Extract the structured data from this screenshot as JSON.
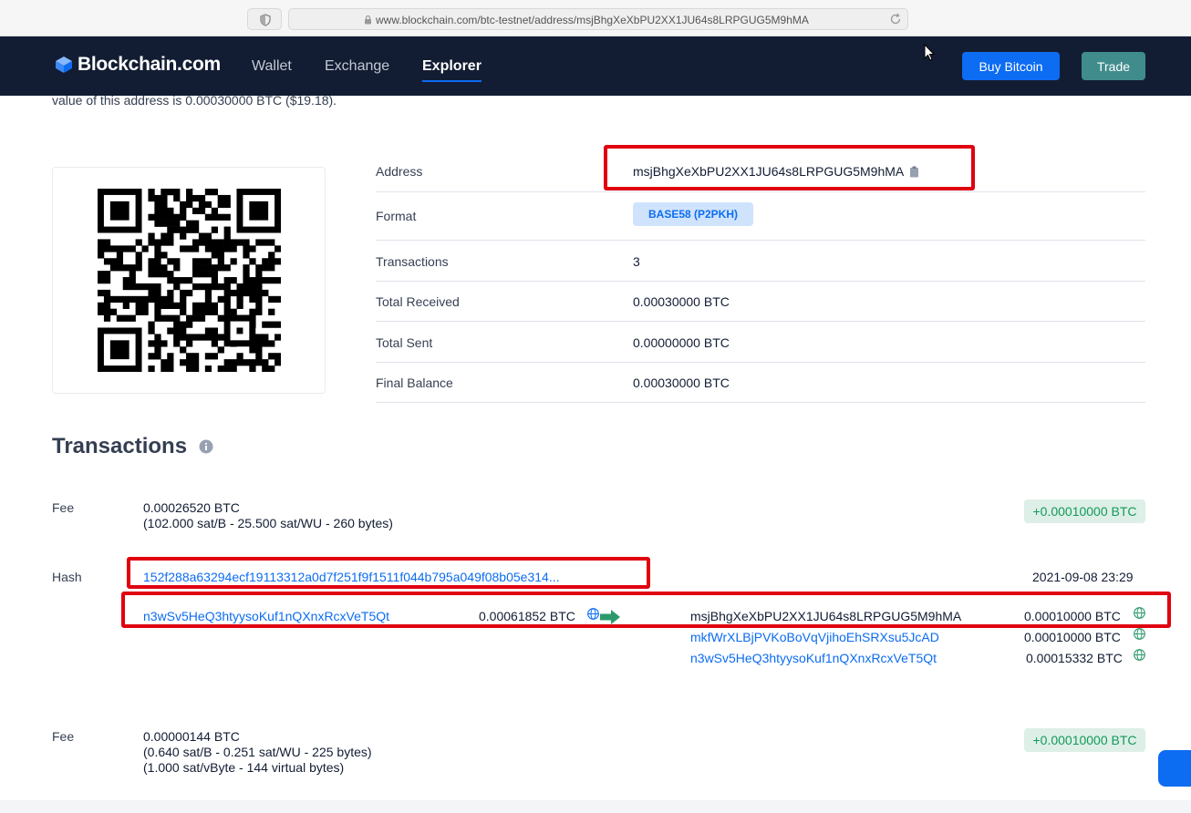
{
  "browser": {
    "url": "www.blockchain.com/btc-testnet/address/msjBhgXeXbPU2XX1JU64s8LRPGUG5M9hMA"
  },
  "header": {
    "logo_text": "Blockchain.com",
    "nav": [
      "Wallet",
      "Exchange",
      "Explorer"
    ],
    "active_nav": "Explorer",
    "buy_label": "Buy Bitcoin",
    "trade_label": "Trade"
  },
  "intro": "value of this address is 0.00030000 BTC ($19.18).",
  "summary": {
    "address_label": "Address",
    "address_value": "msjBhgXeXbPU2XX1JU64s8LRPGUG5M9hMA",
    "format_label": "Format",
    "format_value": "BASE58 (P2PKH)",
    "transactions_label": "Transactions",
    "transactions_value": "3",
    "received_label": "Total Received",
    "received_value": "0.00030000 BTC",
    "sent_label": "Total Sent",
    "sent_value": "0.00000000 BTC",
    "balance_label": "Final Balance",
    "balance_value": "0.00030000 BTC"
  },
  "transactions_title": "Transactions",
  "tx1": {
    "fee_label": "Fee",
    "fee_value": "0.00026520 BTC",
    "fee_detail": "(102.000 sat/B - 25.500 sat/WU - 260 bytes)",
    "amount_badge": "+0.00010000 BTC",
    "hash_label": "Hash",
    "hash_value": "152f288a63294ecf19113312a0d7f251f9f1511f044b795a049f08b05e314...",
    "timestamp": "2021-09-08 23:29",
    "input_address": "n3wSv5HeQ3htyysoKuf1nQXnxRcxVeT5Qt",
    "input_amount": "0.00061852 BTC",
    "outputs": [
      {
        "address": "msjBhgXeXbPU2XX1JU64s8LRPGUG5M9hMA",
        "amount": "0.00010000 BTC"
      },
      {
        "address": "mkfWrXLBjPVKoBoVqVjihoEhSRXsu5JcAD",
        "amount": "0.00010000 BTC"
      },
      {
        "address": "n3wSv5HeQ3htyysoKuf1nQXnxRcxVeT5Qt",
        "amount": "0.00015332 BTC"
      }
    ]
  },
  "tx2": {
    "fee_label": "Fee",
    "fee_value": "0.00000144 BTC",
    "fee_detail_1": "(0.640 sat/B - 0.251 sat/WU - 225 bytes)",
    "fee_detail_2": "(1.000 sat/vByte - 144 virtual bytes)",
    "amount_badge": "+0.00010000 BTC"
  },
  "colors": {
    "header_bg": "#121d33",
    "accent_blue": "#0c6cf2",
    "trade_teal": "#408c8c",
    "positive_green": "#129a5a",
    "highlight_red": "#e0000f"
  }
}
